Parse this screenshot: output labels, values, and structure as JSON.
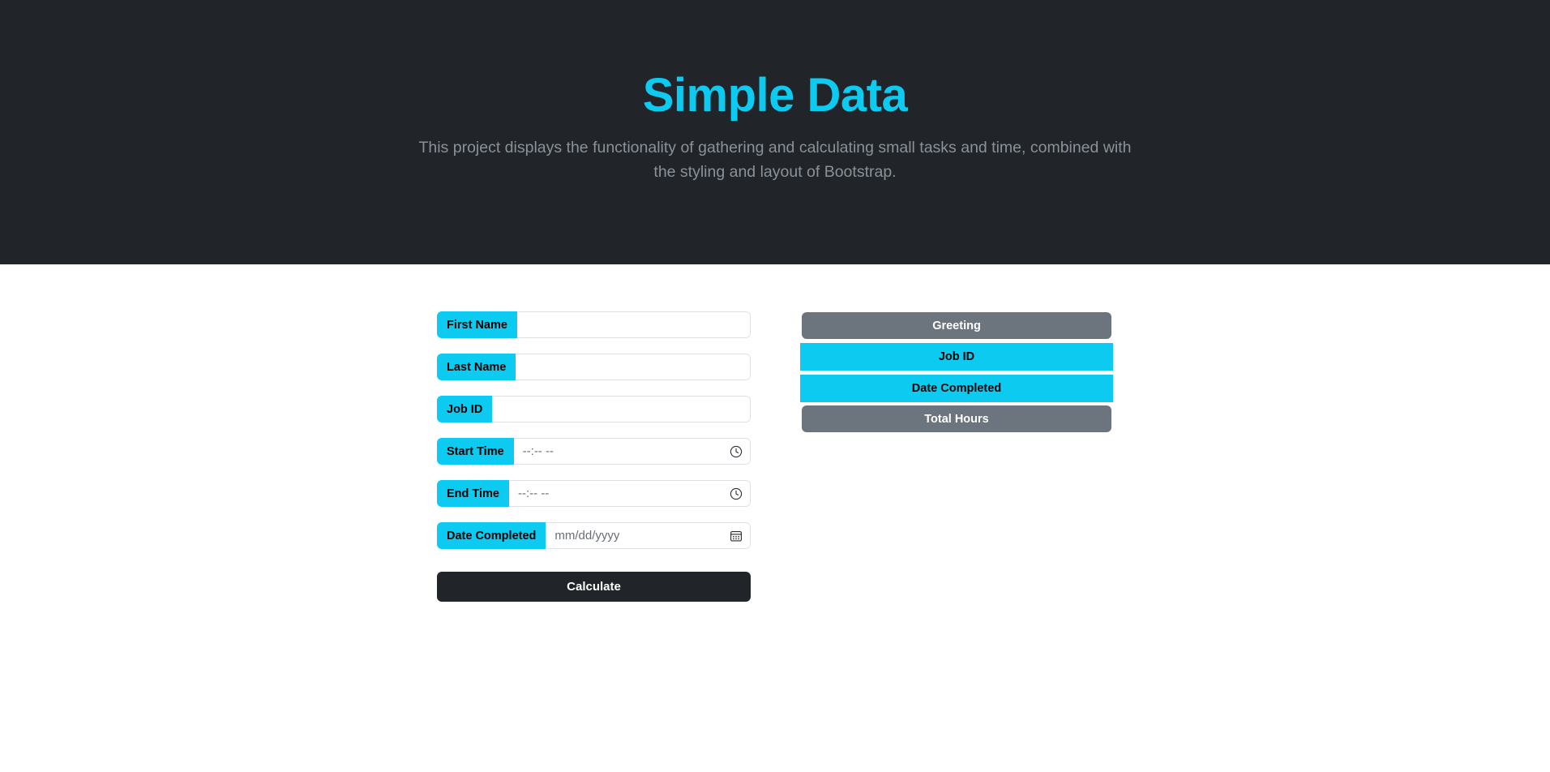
{
  "hero": {
    "title": "Simple Data",
    "subtitle": "This project displays the functionality of gathering and calculating small tasks and time, combined with the styling and layout of Bootstrap.",
    "title_color": "#0dcaf0",
    "background_color": "#212529",
    "subtitle_color": "#8a9199"
  },
  "form": {
    "fields": [
      {
        "label": "First Name",
        "value": "",
        "placeholder": "",
        "icon": "",
        "type": "text"
      },
      {
        "label": "Last Name",
        "value": "",
        "placeholder": "",
        "icon": "",
        "type": "text"
      },
      {
        "label": "Job ID",
        "value": "",
        "placeholder": "",
        "icon": "",
        "type": "text"
      },
      {
        "label": "Start Time",
        "value": "--:-- --",
        "placeholder": "--:-- --",
        "icon": "clock-icon",
        "type": "time"
      },
      {
        "label": "End Time",
        "value": "--:-- --",
        "placeholder": "--:-- --",
        "icon": "clock-icon",
        "type": "time"
      },
      {
        "label": "Date Completed",
        "value": "mm/dd/yyyy",
        "placeholder": "mm/dd/yyyy",
        "icon": "calendar-icon",
        "type": "date"
      }
    ],
    "submit_label": "Calculate",
    "label_background": "#0dcaf0",
    "label_text_color": "#000000",
    "submit_background": "#212529"
  },
  "results": {
    "panels": [
      {
        "label": "Greeting",
        "style": "secondary",
        "background": "#6c757d",
        "text_color": "#ffffff"
      },
      {
        "label": "Job ID",
        "style": "info",
        "background": "#0dcaf0",
        "text_color": "#000000"
      },
      {
        "label": "Date Completed",
        "style": "info",
        "background": "#0dcaf0",
        "text_color": "#000000"
      },
      {
        "label": "Total Hours",
        "style": "secondary",
        "background": "#6c757d",
        "text_color": "#ffffff"
      }
    ]
  }
}
